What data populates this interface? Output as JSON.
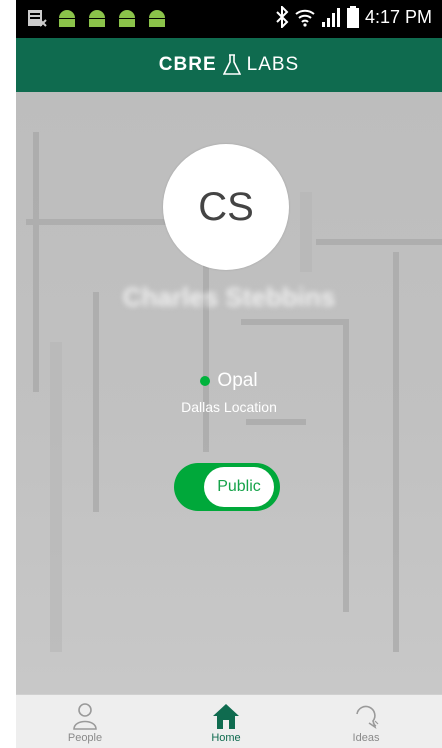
{
  "status_bar": {
    "time": "4:17 PM",
    "left_icons": [
      "notification-icon",
      "android-icon",
      "android-icon",
      "android-icon",
      "android-icon"
    ],
    "right_icons": [
      "bluetooth-icon",
      "wifi-icon",
      "signal-icon",
      "battery-icon"
    ]
  },
  "header": {
    "brand_main": "CBRE",
    "brand_sub": "LABS",
    "brand_color": "#0f6b4f"
  },
  "profile": {
    "initials": "CS",
    "name": "Charles Stebbins",
    "status_label": "Opal",
    "status_color": "#00b33c",
    "location": "Dallas Location"
  },
  "visibility_toggle": {
    "label": "Public",
    "state": "on",
    "color": "#00a83a"
  },
  "bottom_nav": {
    "items": [
      {
        "label": "People",
        "icon": "person-icon",
        "active": false
      },
      {
        "label": "Home",
        "icon": "home-icon",
        "active": true
      },
      {
        "label": "Ideas",
        "icon": "lightbulb-icon",
        "active": false
      }
    ]
  }
}
